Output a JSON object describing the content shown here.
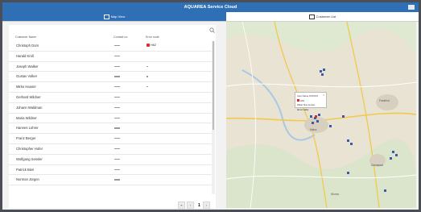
{
  "titlebar": {
    "title": "AQUAREA Service Cloud"
  },
  "tabs": {
    "map": "Map View",
    "list": "Customer List"
  },
  "table": {
    "headers": [
      "Customer Name",
      "Contact no.",
      "Error code"
    ],
    "rows": [
      {
        "name": "Christoph Dorn",
        "status": "alert",
        "badge": "H62"
      },
      {
        "name": "Harald Kroll",
        "status": "dash"
      },
      {
        "name": "Joseph Walker",
        "status": "dot"
      },
      {
        "name": "Gustav Volker",
        "status": "dot"
      },
      {
        "name": "Mirko Hauser",
        "status": "dot"
      },
      {
        "name": "Gerhard Wildner",
        "status": "dash"
      },
      {
        "name": "Johann Waldman",
        "status": "dash"
      },
      {
        "name": "Maria Wildner",
        "status": "dash"
      },
      {
        "name": "Hannes Lohrer",
        "status": "dash"
      },
      {
        "name": "Franz Berger",
        "status": "dash"
      },
      {
        "name": "Christopher Hofer",
        "status": "dash"
      },
      {
        "name": "Wolfgang Sessler",
        "status": "dash"
      },
      {
        "name": "Patrick Bieri",
        "status": "dash"
      },
      {
        "name": "Norman Jürgen",
        "status": "dash"
      }
    ]
  },
  "pager": {
    "first": "«",
    "prev": "‹",
    "current": "1",
    "next": "›"
  },
  "map": {
    "popup": {
      "line1": "User Name XXXXXX",
      "badge": "H62",
      "line3": "Water flow sensor abnormality"
    },
    "labels": [
      "Frankfurt",
      "Mainz",
      "Darmstadt",
      "Worms"
    ]
  },
  "colors": {
    "brand": "#2f6fb5",
    "alert": "#d62c2c"
  }
}
